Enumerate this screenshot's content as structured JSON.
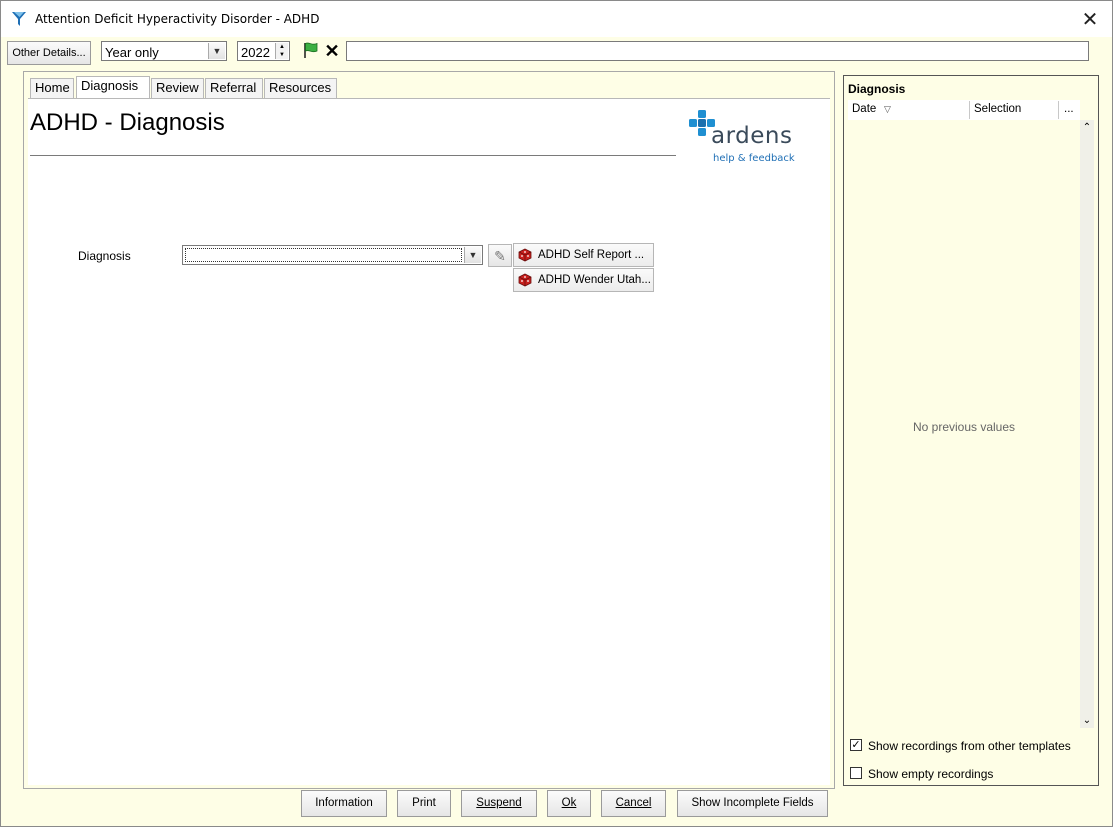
{
  "window": {
    "title": "Attention Deficit Hyperactivity Disorder - ADHD",
    "close_glyph": "✕"
  },
  "toolbar": {
    "other_details_label": "Other Details...",
    "date_mode": "Year only",
    "year": "2022",
    "long_input_value": ""
  },
  "tabs": [
    {
      "label": "Home",
      "active": false
    },
    {
      "label": "Diagnosis",
      "active": true
    },
    {
      "label": "Review",
      "active": false
    },
    {
      "label": "Referral",
      "active": false
    },
    {
      "label": "Resources",
      "active": false
    }
  ],
  "main": {
    "page_title": "ADHD - Diagnosis",
    "logo_word": "ardens",
    "logo_link": "help & feedback",
    "diagnosis_label": "Diagnosis",
    "diagnosis_value": "",
    "quick_buttons": [
      "ADHD Self Report ...",
      "ADHD Wender Utah..."
    ]
  },
  "right_panel": {
    "title": "Diagnosis",
    "col_date": "Date",
    "col_selection": "Selection",
    "col_more": "...",
    "empty_message": "No previous values",
    "show_other_templates_label": "Show recordings from other templates",
    "show_other_templates_checked": true,
    "show_empty_label": "Show empty recordings",
    "show_empty_checked": false
  },
  "bottom_buttons": {
    "information": "Information",
    "print": "Print",
    "suspend": "Suspend",
    "ok": "Ok",
    "cancel": "Cancel",
    "show_incomplete": "Show Incomplete Fields"
  },
  "colors": {
    "panel_bg": "#fefee6",
    "logo_blue": "#1f8fd1",
    "link_blue": "#1f6fb5"
  },
  "icons": {
    "app": "funnel-icon",
    "flag": "green-flag-icon",
    "clear": "x-icon",
    "edit": "pencil-icon",
    "questionnaire": "red-dice-icon"
  }
}
